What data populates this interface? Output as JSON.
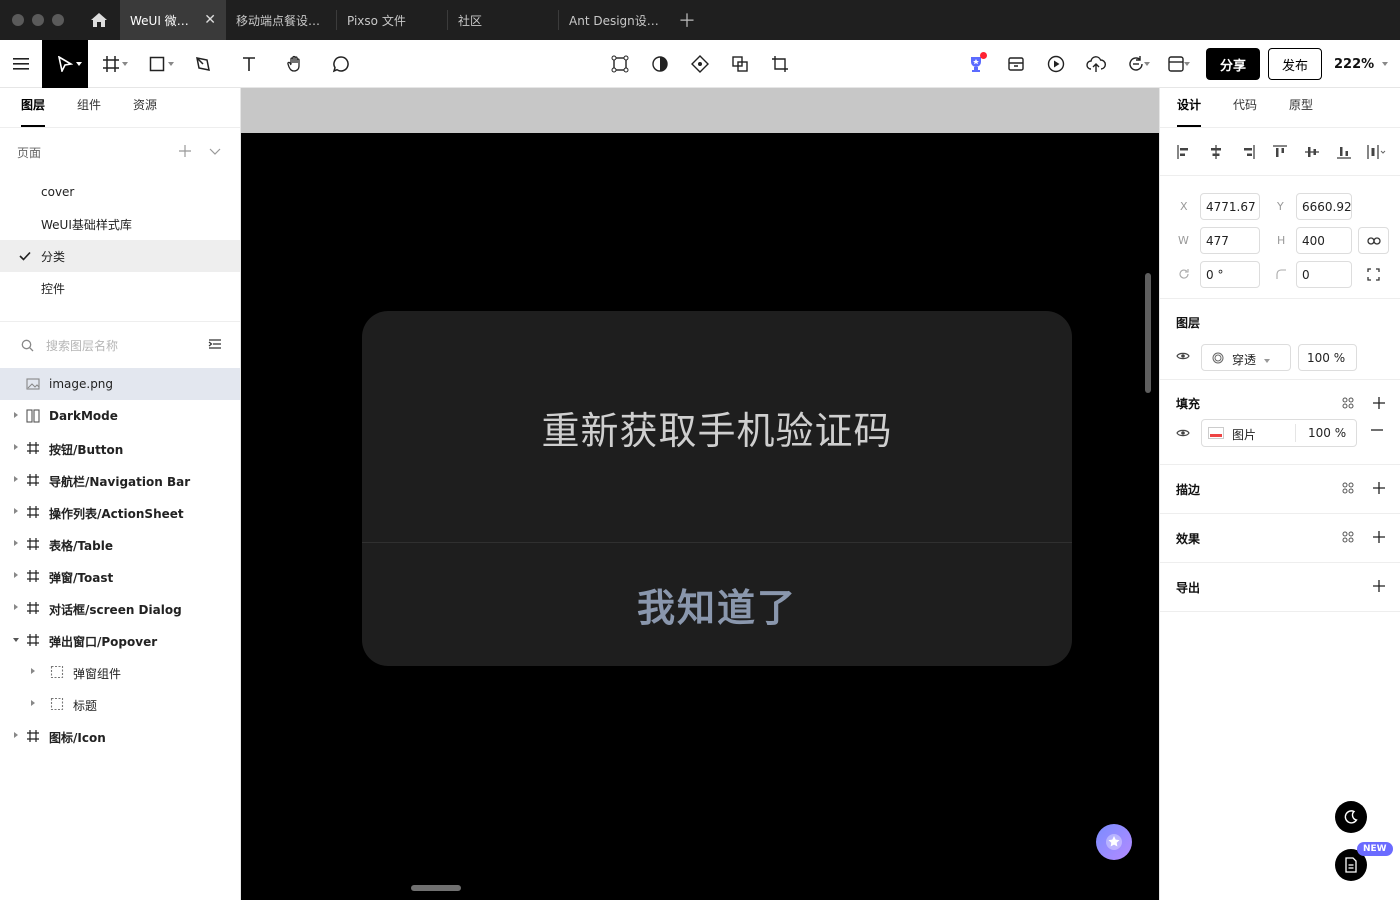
{
  "tabs": [
    {
      "label": "WeUI 微信设计规范",
      "active": true
    },
    {
      "label": "移动端点餐设计规范"
    },
    {
      "label": "Pixso 文件"
    },
    {
      "label": "社区"
    },
    {
      "label": "Ant Design设计规范"
    }
  ],
  "toolbar": {
    "share_label": "分享",
    "publish_label": "发布",
    "zoom": "222%"
  },
  "left_panel": {
    "tabs": [
      "图层",
      "组件",
      "资源"
    ],
    "pages_label": "页面",
    "pages": [
      {
        "label": "cover"
      },
      {
        "label": "WeUI基础样式库"
      },
      {
        "label": "分类",
        "selected": true
      },
      {
        "label": "控件"
      }
    ],
    "search_placeholder": "搜索图层名称",
    "layers": [
      {
        "name": "image.png"
      },
      {
        "name": "DarkMode"
      },
      {
        "name": "按钮/Button"
      },
      {
        "name": "导航栏/Navigation Bar"
      },
      {
        "name": "操作列表/ActionSheet"
      },
      {
        "name": "表格/Table"
      },
      {
        "name": "弹窗/Toast"
      },
      {
        "name": "对话框/screen Dialog"
      },
      {
        "name": "弹出窗口/Popover"
      },
      {
        "name": "弹窗组件"
      },
      {
        "name": "标题"
      },
      {
        "name": "图标/Icon"
      }
    ]
  },
  "canvas": {
    "dialog_title": "重新获取手机验证码",
    "dialog_button": "我知道了"
  },
  "right_panel": {
    "tabs": [
      "设计",
      "代码",
      "原型"
    ],
    "x_label": "X",
    "x_value": "4771.67",
    "y_label": "Y",
    "y_value": "6660.92",
    "w_label": "W",
    "w_value": "477",
    "h_label": "H",
    "h_value": "400",
    "rotation_value": "0 °",
    "radius_value": "0",
    "layer_section": "图层",
    "blend_mode": "穿透",
    "layer_opacity": "100 %",
    "fill_section": "填充",
    "fill_type": "图片",
    "fill_opacity": "100 %",
    "stroke_section": "描边",
    "effect_section": "效果",
    "export_section": "导出"
  },
  "floating": {
    "new_badge": "NEW"
  },
  "colors": {
    "titlebar": "#1f1f1f",
    "active_tab": "#3a3a3a",
    "canvas_bg": "#000000",
    "dialog_bg": "#1e1e1e",
    "dialog_button_text": "#8a97ad",
    "accent": "#000000"
  }
}
